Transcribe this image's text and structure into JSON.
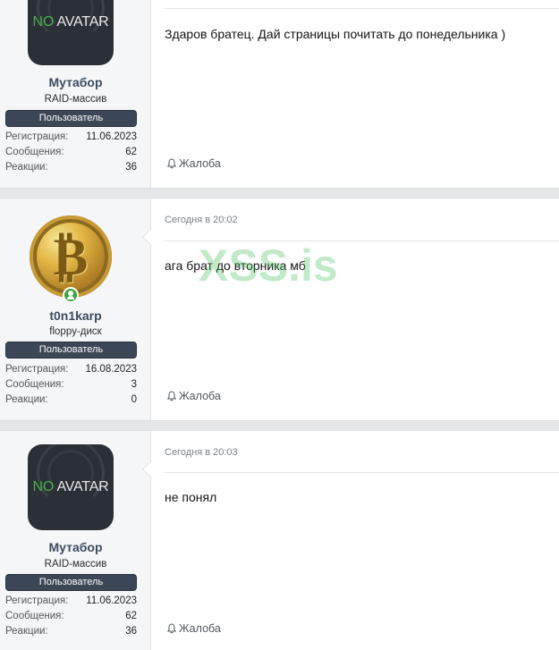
{
  "posts": [
    {
      "user": {
        "name": "Мутабор",
        "title": "RAID-массив",
        "banner": "Пользователь",
        "avatar": {
          "type": "no-avatar",
          "no": "NO",
          "avatar": "AVATAR"
        }
      },
      "stats": [
        {
          "label": "Регистрация:",
          "value": "11.06.2023"
        },
        {
          "label": "Сообщения:",
          "value": "62"
        },
        {
          "label": "Реакции:",
          "value": "36"
        }
      ],
      "time": "",
      "message": "Здаров братец. Дай страницы почитать до понедельника )",
      "report": "Жалоба"
    },
    {
      "user": {
        "name": "t0n1karp",
        "title": "floppy-диск",
        "banner": "Пользователь",
        "avatar": {
          "type": "bitcoin",
          "symbol": "₿"
        },
        "online": true
      },
      "stats": [
        {
          "label": "Регистрация:",
          "value": "16.08.2023"
        },
        {
          "label": "Сообщения:",
          "value": "3"
        },
        {
          "label": "Реакции:",
          "value": "0"
        }
      ],
      "time": "Сегодня в 20:02",
      "message": "ага брат до вторника мб",
      "report": "Жалоба"
    },
    {
      "user": {
        "name": "Мутабор",
        "title": "RAID-массив",
        "banner": "Пользователь",
        "avatar": {
          "type": "no-avatar",
          "no": "NO",
          "avatar": "AVATAR"
        }
      },
      "stats": [
        {
          "label": "Регистрация:",
          "value": "11.06.2023"
        },
        {
          "label": "Сообщения:",
          "value": "62"
        },
        {
          "label": "Реакции:",
          "value": "36"
        }
      ],
      "time": "Сегодня в 20:03",
      "message": "не понял",
      "report": "Жалоба"
    }
  ],
  "watermark": "XSS.is"
}
